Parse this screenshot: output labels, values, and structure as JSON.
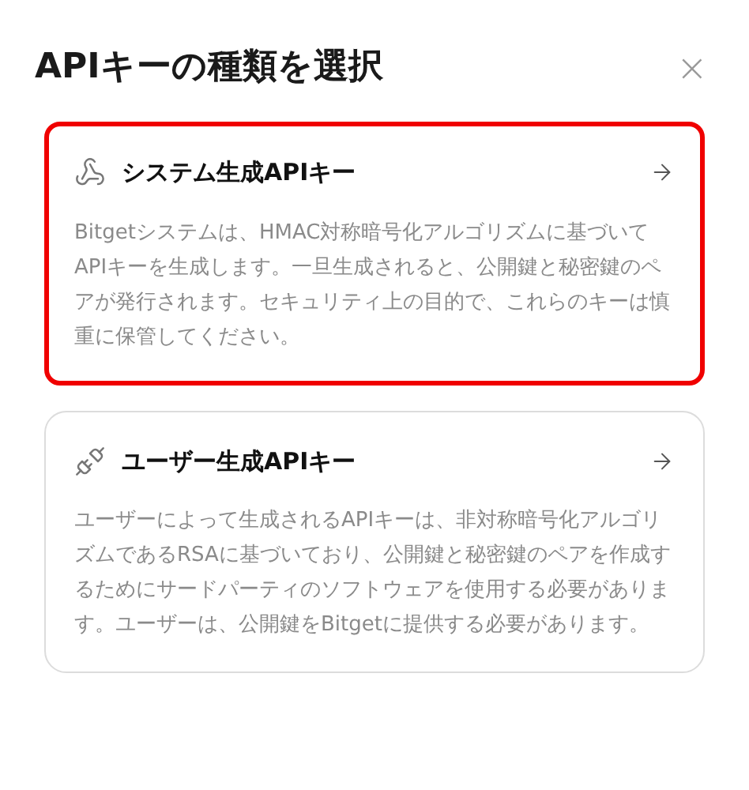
{
  "dialog": {
    "title": "APIキーの種類を選択",
    "close": "×"
  },
  "options": [
    {
      "kind": "system",
      "title": "システム生成APIキー",
      "description": "Bitgetシステムは、HMAC対称暗号化アルゴリズムに基づいてAPIキーを生成します。一旦生成されると、公開鍵と秘密鍵のペアが発行されます。セキュリティ上の目的で、これらのキーは慎重に保管してください。",
      "selected": true
    },
    {
      "kind": "user",
      "title": "ユーザー生成APIキー",
      "description": "ユーザーによって生成されるAPIキーは、非対称暗号化アルゴリズムであるRSAに基づいており、公開鍵と秘密鍵のペアを作成するためにサードパーティのソフトウェアを使用する必要があります。ユーザーは、公開鍵をBitgetに提供する必要があります。",
      "selected": false
    }
  ]
}
